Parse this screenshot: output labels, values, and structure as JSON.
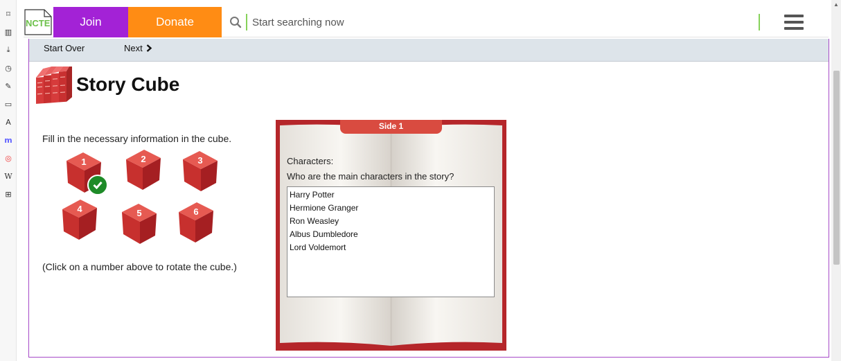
{
  "sidebar": {
    "icons": [
      "bookmark-icon",
      "reading-view-icon",
      "download-icon",
      "history-icon",
      "edit-icon",
      "calendar-icon",
      "translate-icon",
      "mastodon-icon",
      "vivaldi-icon",
      "wikipedia-icon",
      "add-panel-icon"
    ],
    "glyphs": [
      "⌑",
      "▥",
      "⤓",
      "◷",
      "✎",
      "▭",
      "A",
      "m",
      "◎",
      "W",
      "⊞"
    ]
  },
  "header": {
    "logo_text": "NCTE",
    "join_label": "Join",
    "donate_label": "Donate",
    "search_placeholder": "Start searching now"
  },
  "nav": {
    "start_over": "Start Over",
    "next": "Next"
  },
  "page": {
    "title": "Story Cube",
    "instruction": "Fill in the necessary information in the cube.",
    "hint": "(Click on a number above to rotate the cube.)",
    "cubes": [
      "1",
      "2",
      "3",
      "4",
      "5",
      "6"
    ],
    "completed_cube": "1"
  },
  "book": {
    "tab": "Side 1",
    "label": "Characters:",
    "question": "Who are the main characters in the story?",
    "answer": "Harry Potter\nHermione Granger\nRon Weasley\nAlbus Dumbledore\nLord Voldemort"
  },
  "colors": {
    "join": "#a322d6",
    "donate": "#ff8c14",
    "accent_green": "#86d25a",
    "frame": "#a649c8",
    "book_red": "#b5262a",
    "cube_red": "#d9413d"
  }
}
